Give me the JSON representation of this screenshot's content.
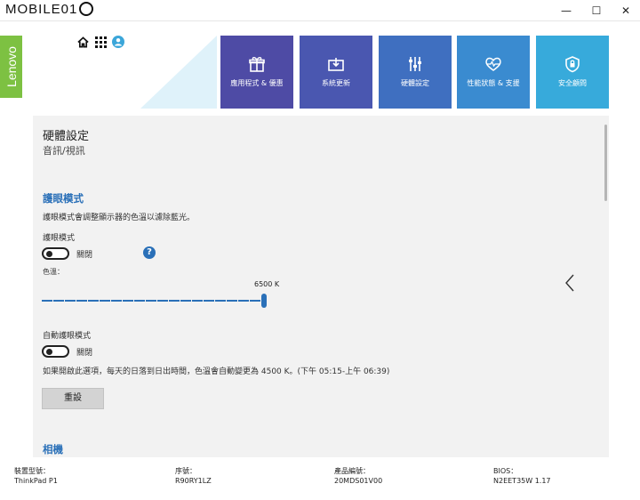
{
  "titlebar": {
    "logo_text": "MOBILE01",
    "minimize": "—",
    "maximize": "☐",
    "close": "✕"
  },
  "brand": {
    "name": "Lenovo",
    "color": "#7dc142"
  },
  "top_icons": [
    "home-icon",
    "apps-grid-icon",
    "user-icon"
  ],
  "tiles": [
    {
      "label": "應用程式 & 優惠",
      "icon": "gift-icon",
      "color": "#4e4ba5"
    },
    {
      "label": "系統更新",
      "icon": "update-icon",
      "color": "#4a57b0"
    },
    {
      "label": "硬體設定",
      "icon": "sliders-icon",
      "color": "#3f6fc0"
    },
    {
      "label": "性能狀態 & 支援",
      "icon": "heart-pulse-icon",
      "color": "#3a8bd0"
    },
    {
      "label": "安全顧問",
      "icon": "shield-icon",
      "color": "#37aadb"
    }
  ],
  "page": {
    "title": "硬體設定",
    "subtitle": "音訊/視訊"
  },
  "eye_mode": {
    "section_title": "護眼模式",
    "description": "護眼模式會調整顯示器的色溫以濾除藍光。",
    "setting_label": "護眼模式",
    "toggle_state": "關閉",
    "color_temp_label": "色溫：",
    "slider_value": "6500 K",
    "auto_label": "自動護眼模式",
    "auto_toggle_state": "關閉",
    "auto_description": "如果開啟此選項，每天的日落到日出時間，色溫會自動變更為 4500 K。(下午 05:15-上午 06:39)",
    "reset_button": "重設"
  },
  "camera": {
    "section_title": "相機"
  },
  "footer": [
    {
      "label": "裝置型號：",
      "value": "ThinkPad P1"
    },
    {
      "label": "序號：",
      "value": "R90RY1LZ"
    },
    {
      "label": "產品編號：",
      "value": "20MDS01V00"
    },
    {
      "label": "BIOS：",
      "value": "N2EET35W 1.17"
    }
  ],
  "colors": {
    "accent": "#2a70b8",
    "panel_bg": "#f2f2f2"
  }
}
